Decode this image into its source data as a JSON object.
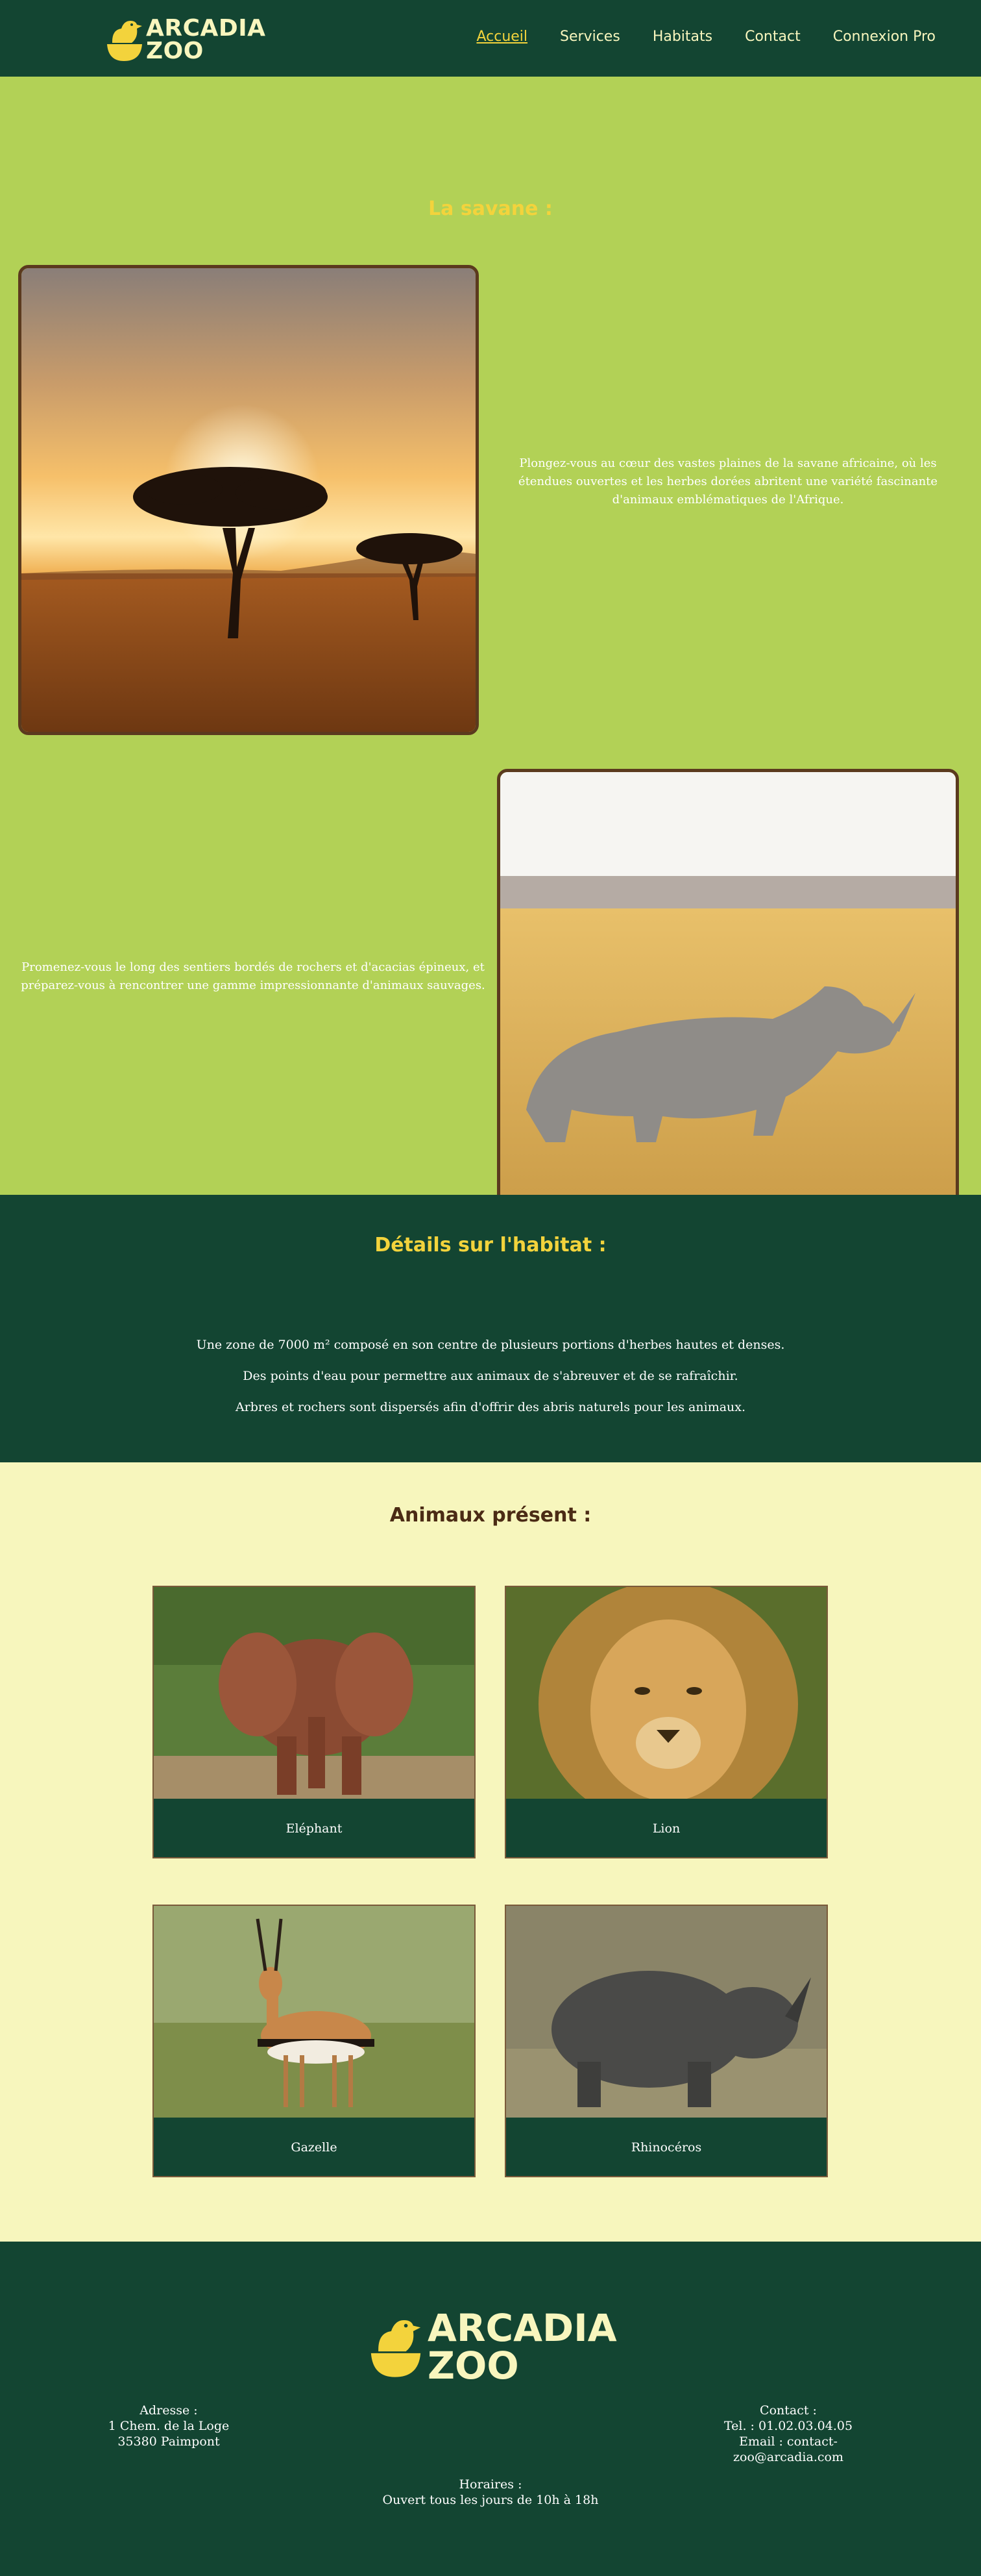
{
  "header": {
    "logo": {
      "line1": "ARCADIA",
      "line2": "ZOO",
      "icon": "bird-icon"
    },
    "nav": [
      {
        "label": "Accueil",
        "active": true
      },
      {
        "label": "Services",
        "active": false
      },
      {
        "label": "Habitats",
        "active": false
      },
      {
        "label": "Contact",
        "active": false
      },
      {
        "label": "Connexion Pro",
        "active": false
      }
    ]
  },
  "savane": {
    "title": "La savane :",
    "photo1_alt": "acacia-sunset-photo",
    "text1": "Plongez-vous au cœur des vastes plaines de la savane africaine, où les étendues ouvertes et les herbes dorées abritent une variété fascinante d'animaux emblématiques de l'Afrique.",
    "photo2_alt": "rhinoceros-photo",
    "text2": "Promenez-vous le long des sentiers bordés de rochers et d'acacias épineux, et préparez-vous à rencontrer une gamme impressionnante d'animaux sauvages."
  },
  "details": {
    "title": "Détails sur l'habitat :",
    "lines": [
      "Une zone de 7000 m² composé en son centre de plusieurs portions d'herbes hautes et denses.",
      "Des points d'eau pour permettre aux animaux de s'abreuver et de se rafraîchir.",
      "Arbres et rochers sont dispersés afin d'offrir des abris naturels pour les animaux."
    ]
  },
  "animals": {
    "title": "Animaux présent :",
    "cards": [
      {
        "name": "Eléphant"
      },
      {
        "name": "Lion"
      },
      {
        "name": "Gazelle"
      },
      {
        "name": "Rhinocéros"
      }
    ]
  },
  "footer": {
    "logo": {
      "line1": "ARCADIA",
      "line2": "ZOO"
    },
    "address": {
      "heading": "Adresse :",
      "line1": "1 Chem. de la Loge",
      "line2": "35380 Paimpont"
    },
    "contact": {
      "heading": "Contact :",
      "tel": "Tel. : 01.02.03.04.05",
      "email1": "Email : contact-",
      "email2": "zoo@arcadia.com"
    },
    "hours": {
      "heading": "Horaires :",
      "line": "Ouvert tous  les jours de 10h à 18h"
    }
  },
  "colors": {
    "dark_green": "#134532",
    "lime": "#b2d156",
    "cream": "#f7f6bd",
    "yellow": "#f3d33c",
    "brown": "#5b3a1e"
  }
}
